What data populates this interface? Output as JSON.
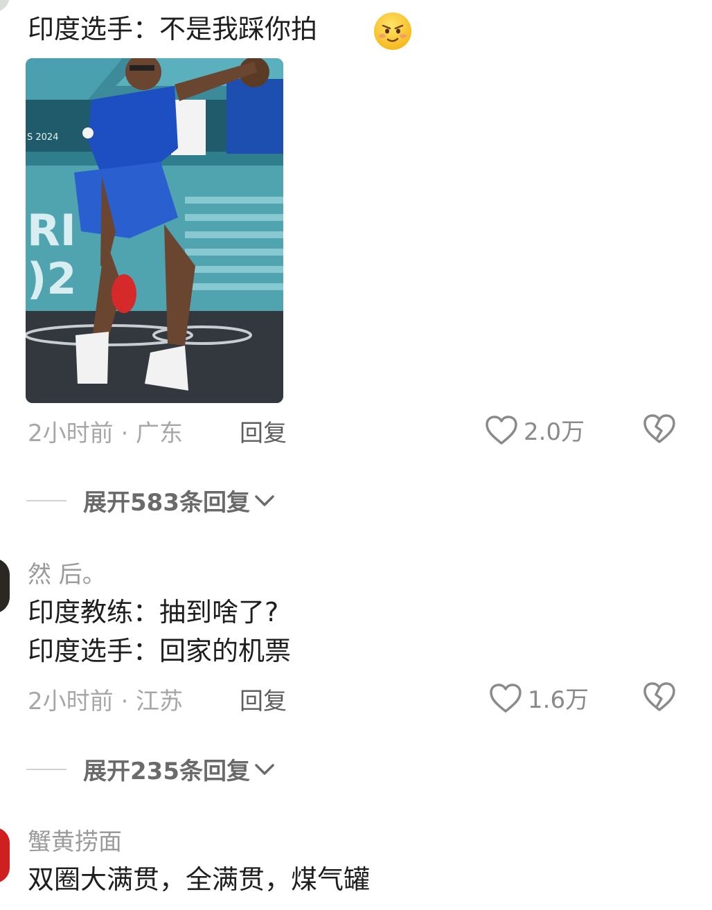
{
  "comments": [
    {
      "lines": [
        "印度选手：不是我踩你拍"
      ],
      "emoji": "smirk-emoji",
      "image": "table-tennis-player-photo",
      "time_location": "2小时前 · 广东",
      "reply_label": "回复",
      "like_count": "2.0万",
      "expand_label": "展开583条回复"
    },
    {
      "username": "然 后。",
      "lines": [
        "印度教练：抽到啥了?",
        "印度选手：回家的机票"
      ],
      "time_location": "2小时前 · 江苏",
      "reply_label": "回复",
      "like_count": "1.6万",
      "expand_label": "展开235条回复"
    },
    {
      "username": "蟹黄捞面",
      "lines": [
        "双圈大满贯，全满贯，煤气罐"
      ]
    }
  ],
  "colors": {
    "meta_gray": "#a7a7a7",
    "icon_gray": "#8a8a8a",
    "text_dark": "#1e1e1e"
  }
}
